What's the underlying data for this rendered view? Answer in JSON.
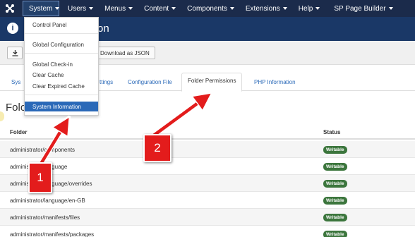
{
  "navbar": {
    "items": [
      {
        "label": "System",
        "caret": true
      },
      {
        "label": "Users",
        "caret": true
      },
      {
        "label": "Menus",
        "caret": true
      },
      {
        "label": "Content",
        "caret": true
      },
      {
        "label": "Components",
        "caret": true
      },
      {
        "label": "Extensions",
        "caret": true
      },
      {
        "label": "Help",
        "caret": true
      },
      {
        "label": "SP Page Builder",
        "caret": true
      }
    ]
  },
  "titlebar": {
    "title_partial": "on"
  },
  "toolbar": {
    "download_json_label": "Download as JSON"
  },
  "tabs": [
    {
      "label": "Sys"
    },
    {
      "label": "ttings"
    },
    {
      "label": "Configuration File"
    },
    {
      "label": "Folder Permissions",
      "active": true
    },
    {
      "label": "PHP Information"
    }
  ],
  "section_title_partial": "Folo",
  "table": {
    "headers": {
      "folder": "Folder",
      "status": "Status"
    },
    "rows": [
      {
        "folder": "administrator/components",
        "status": "Writable"
      },
      {
        "folder": "administrator/language",
        "status": "Writable"
      },
      {
        "folder": "administrator/language/overrides",
        "status": "Writable"
      },
      {
        "folder": "administrator/language/en-GB",
        "status": "Writable"
      },
      {
        "folder": "administrator/manifests/files",
        "status": "Writable"
      },
      {
        "folder": "administrator/manifests/packages",
        "status": "Writable"
      }
    ]
  },
  "dropdown": {
    "items": [
      {
        "label": "Control Panel"
      },
      {
        "label": "Global Configuration"
      },
      {
        "label": "Global Check-in"
      },
      {
        "label": "Clear Cache"
      },
      {
        "label": "Clear Expired Cache"
      },
      {
        "label": "System Information",
        "active": true
      }
    ]
  },
  "annotations": [
    {
      "label": "1"
    },
    {
      "label": "2"
    }
  ],
  "colors": {
    "navbar": "#1b2b4b",
    "titlebar": "#1a3867",
    "active_item": "#2a69b8",
    "badge_success": "#3c763d",
    "annotation": "#e31c1c"
  }
}
